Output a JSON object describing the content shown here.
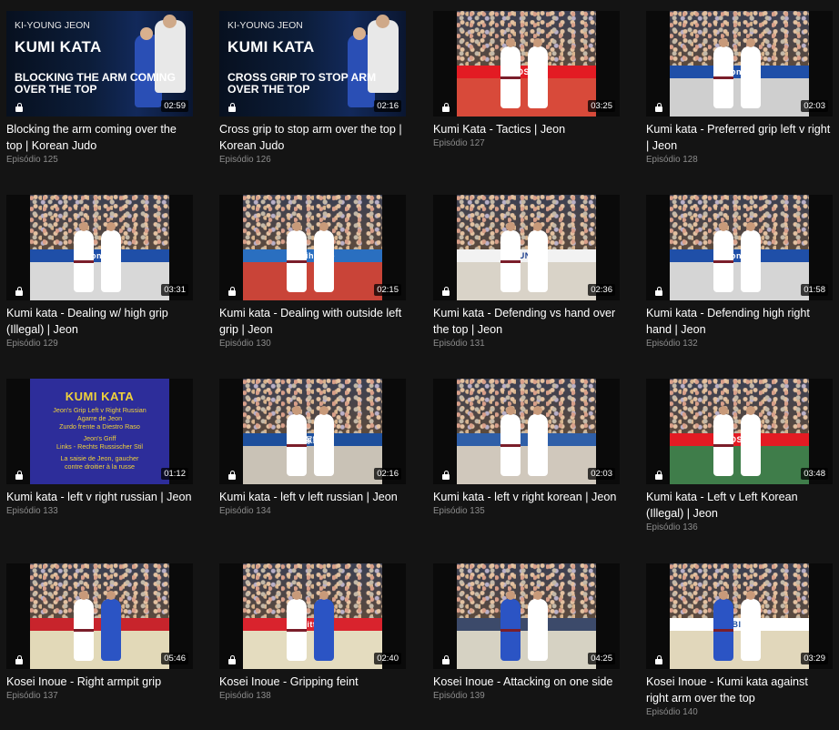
{
  "episodes": [
    {
      "title": "Blocking the arm coming over the top | Korean Judo",
      "episode": "Episódio 125",
      "duration": "02:59",
      "locked": true,
      "poster": {
        "coach": "KI-YOUNG JEON",
        "heading": "KUMI KATA",
        "subtitle": "BLOCKING THE ARM COMING OVER THE TOP"
      }
    },
    {
      "title": "Cross grip to stop arm over the top | Korean Judo",
      "episode": "Episódio 126",
      "duration": "02:16",
      "locked": true,
      "poster": {
        "coach": "KI-YOUNG JEON",
        "heading": "KUMI KATA",
        "subtitle": "CROSS GRIP TO STOP ARM OVER THE TOP"
      }
    },
    {
      "title": "Kumi Kata - Tactics | Jeon",
      "episode": "Episódio 127",
      "duration": "03:25",
      "locked": true,
      "scene": {
        "banner": "BOSCH",
        "banner_bg": "#e31b23",
        "banner_fg": "#ffffff",
        "mat": "#d84a3a",
        "fighters": [
          "#ffffff",
          "#ffffff"
        ]
      }
    },
    {
      "title": "Kumi kata - Preferred grip left v right | Jeon",
      "episode": "Episódio 128",
      "duration": "02:03",
      "locked": true,
      "scene": {
        "banner": "Konica",
        "banner_bg": "#1f4fa8",
        "banner_fg": "#ffffff",
        "mat": "#cfcfcf",
        "fighters": [
          "#ffffff",
          "#ffffff"
        ]
      }
    },
    {
      "title": "Kumi kata - Dealing w/ high grip (Illegal) | Jeon",
      "episode": "Episódio 129",
      "duration": "03:31",
      "locked": true,
      "scene": {
        "banner": "Konica",
        "banner_bg": "#1f4fa8",
        "banner_fg": "#ffffff",
        "mat": "#d8d8d8",
        "fighters": [
          "#ffffff",
          "#ffffff"
        ]
      }
    },
    {
      "title": "Kumi kata - Dealing with outside left grip | Jeon",
      "episode": "Episódio 130",
      "duration": "02:15",
      "locked": true,
      "scene": {
        "banner": "mikihouse",
        "banner_bg": "#2a6fc0",
        "banner_fg": "#ffffff",
        "mat": "#c94438",
        "fighters": [
          "#ffffff",
          "#ffffff"
        ]
      }
    },
    {
      "title": "Kumi kata - Defending vs hand over the top | Jeon",
      "episode": "Episódio 131",
      "duration": "02:36",
      "locked": true,
      "scene": {
        "banner": "HYUNDAI",
        "banner_bg": "#f2f2f2",
        "banner_fg": "#1a3c8c",
        "mat": "#d9d3c8",
        "fighters": [
          "#ffffff",
          "#ffffff"
        ]
      }
    },
    {
      "title": "Kumi kata - Defending high right hand | Jeon",
      "episode": "Episódio 132",
      "duration": "01:58",
      "locked": true,
      "scene": {
        "banner": "Konica",
        "banner_bg": "#1f4fa8",
        "banner_fg": "#ffffff",
        "mat": "#d5d5d5",
        "fighters": [
          "#ffffff",
          "#ffffff"
        ]
      }
    },
    {
      "title": "Kumi kata - left v right russian | Jeon",
      "episode": "Episódio 133",
      "duration": "01:12",
      "locked": true,
      "titlecard": {
        "heading": "KUMI KATA",
        "lines_a": [
          "Jeon's Grip Left v Right Russian",
          "Agarre de Jeon",
          "Zurdo frente a Diestro Raso"
        ],
        "lines_b": [
          "Jeon's Griff",
          "Links - Rechts Russischer Stil"
        ],
        "lines_c": [
          "La saisie de Jeon, gaucher",
          "contre droitier à la russe"
        ]
      }
    },
    {
      "title": "Kumi kata - left v left russian | Jeon",
      "episode": "Episódio 134",
      "duration": "02:16",
      "locked": true,
      "scene": {
        "banner": "大塚製薬",
        "banner_bg": "#1d4f9c",
        "banner_fg": "#ffffff",
        "mat": "#c9c2b6",
        "fighters": [
          "#ffffff",
          "#ffffff"
        ]
      }
    },
    {
      "title": "Kumi kata - left v right korean | Jeon",
      "episode": "Episódio 135",
      "duration": "02:03",
      "locked": true,
      "scene": {
        "banner": "",
        "banner_bg": "#2f5fa8",
        "banner_fg": "#ffffff",
        "mat": "#d0c8bc",
        "fighters": [
          "#ffffff",
          "#ffffff"
        ]
      }
    },
    {
      "title": "Kumi kata - Left v Left Korean (Illegal) | Jeon",
      "episode": "Episódio 136",
      "duration": "03:48",
      "locked": true,
      "scene": {
        "banner": "BOSCH",
        "banner_bg": "#e31b23",
        "banner_fg": "#ffffff",
        "mat": "#3f7d4a",
        "fighters": [
          "#ffffff",
          "#ffffff"
        ]
      }
    },
    {
      "title": "Kosei Inoue - Right armpit grip",
      "episode": "Episódio 137",
      "duration": "05:46",
      "locked": true,
      "scene": {
        "banner": "",
        "banner_bg": "#c8242c",
        "banner_fg": "#ffffff",
        "mat": "#e2d9b8",
        "fighters": [
          "#ffffff",
          "#2b54c4"
        ]
      }
    },
    {
      "title": "Kosei Inoue - Gripping feint",
      "episode": "Episódio 138",
      "duration": "02:40",
      "locked": true,
      "scene": {
        "banner": "Vittel",
        "banner_bg": "#d9232d",
        "banner_fg": "#ffffff",
        "mat": "#e4dcbf",
        "fighters": [
          "#ffffff",
          "#2b54c4"
        ]
      }
    },
    {
      "title": "Kosei Inoue - Attacking on one side",
      "episode": "Episódio 139",
      "duration": "04:25",
      "locked": true,
      "scene": {
        "banner": "",
        "banner_bg": "#3c4a6a",
        "banner_fg": "#ffffff",
        "mat": "#d6d2c3",
        "fighters": [
          "#2b54c4",
          "#ffffff"
        ]
      }
    },
    {
      "title": "Kosei Inoue - Kumi kata against right arm over the top",
      "episode": "Episódio 140",
      "duration": "03:29",
      "locked": true,
      "scene": {
        "banner": "ABIES",
        "banner_bg": "#ffffff",
        "banner_fg": "#1e4fa0",
        "mat": "#e1d7bb",
        "fighters": [
          "#2b54c4",
          "#ffffff"
        ]
      }
    }
  ]
}
